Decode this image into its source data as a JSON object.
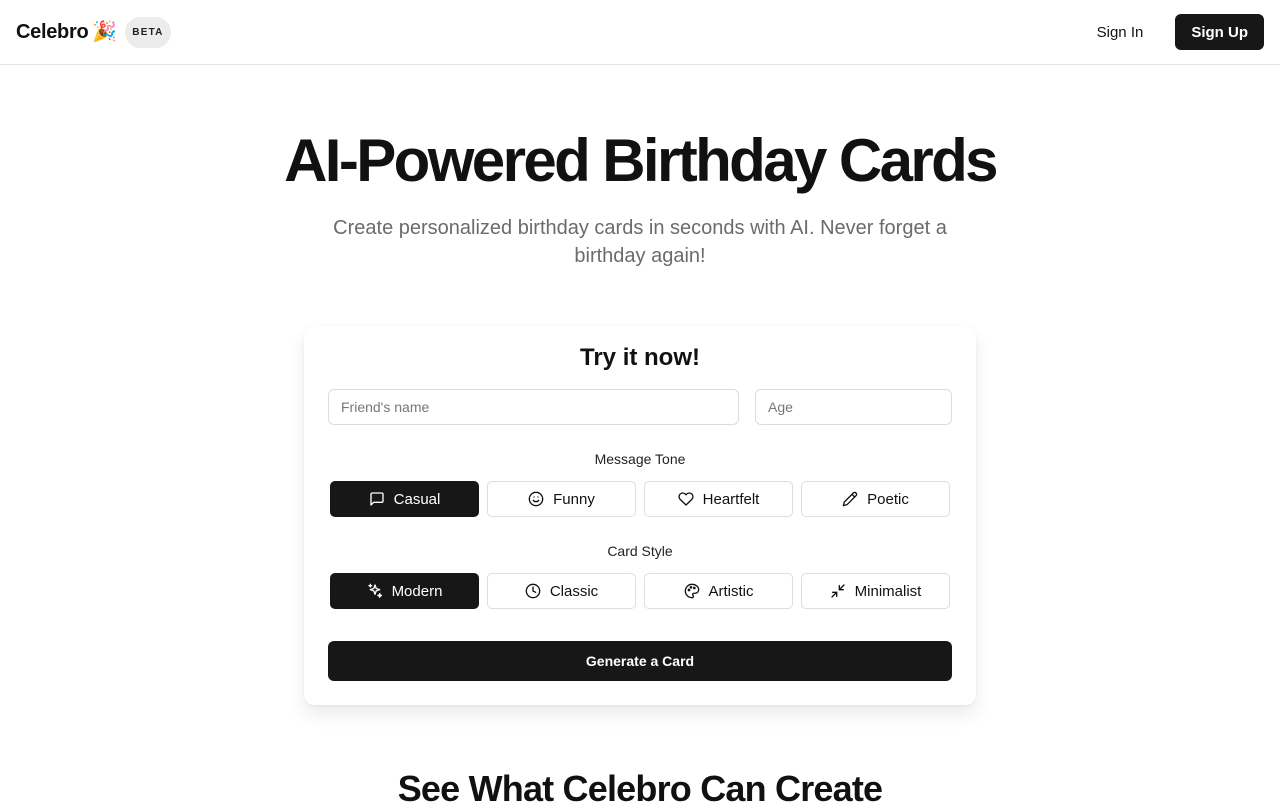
{
  "header": {
    "brand": "Celebro",
    "brand_icon": "party-popper-icon",
    "badge": "BETA",
    "sign_in": "Sign In",
    "sign_up": "Sign Up"
  },
  "hero": {
    "title": "AI-Powered Birthday Cards",
    "subtitle": "Create personalized birthday cards in seconds with AI. Never forget a birthday again!"
  },
  "form": {
    "title": "Try it now!",
    "name_placeholder": "Friend's name",
    "age_placeholder": "Age",
    "tone_label": "Message Tone",
    "tones": [
      {
        "label": "Casual",
        "icon": "message-square-icon",
        "selected": true
      },
      {
        "label": "Funny",
        "icon": "smile-icon",
        "selected": false
      },
      {
        "label": "Heartfelt",
        "icon": "heart-icon",
        "selected": false
      },
      {
        "label": "Poetic",
        "icon": "pen-icon",
        "selected": false
      }
    ],
    "style_label": "Card Style",
    "styles": [
      {
        "label": "Modern",
        "icon": "sparkles-icon",
        "selected": true
      },
      {
        "label": "Classic",
        "icon": "clock-icon",
        "selected": false
      },
      {
        "label": "Artistic",
        "icon": "palette-icon",
        "selected": false
      },
      {
        "label": "Minimalist",
        "icon": "minimize-icon",
        "selected": false
      }
    ],
    "generate": "Generate a Card"
  },
  "showcase": {
    "heading": "See What Celebro Can Create"
  },
  "colors": {
    "primary": "#171717",
    "muted_text": "#6b6b6b",
    "border": "#dddddd"
  }
}
